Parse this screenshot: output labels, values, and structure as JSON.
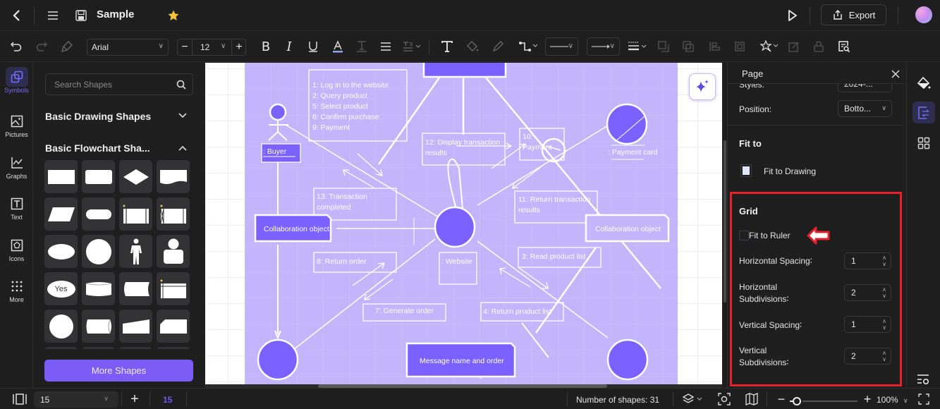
{
  "app": {
    "title": "Sample",
    "export_label": "Export"
  },
  "toolbar": {
    "font_family": "Arial",
    "font_size": "12"
  },
  "rail": {
    "items": [
      {
        "label": "Symbols",
        "icon": "symbols-icon",
        "active": true
      },
      {
        "label": "Pictures",
        "icon": "pictures-icon"
      },
      {
        "label": "Graphs",
        "icon": "graphs-icon"
      },
      {
        "label": "Text",
        "icon": "text-icon"
      },
      {
        "label": "Icons",
        "icon": "icons-icon"
      },
      {
        "label": "More",
        "icon": "more-grid-icon"
      }
    ]
  },
  "shapes_panel": {
    "search_placeholder": "Search Shapes",
    "sections": [
      {
        "title": "Basic Drawing Shapes",
        "expanded": false
      },
      {
        "title": "Basic Flowchart Sha...",
        "expanded": true
      }
    ],
    "tile_yes_label": "Yes",
    "more_shapes_label": "More Shapes"
  },
  "diagram": {
    "actor_label": ": Buyer",
    "messages_box": [
      "1: Log in to the website",
      "2: Query product",
      "5: Select product",
      "6: Confirm purchase",
      "9: Payment"
    ],
    "msg12": [
      "12: Display transaction",
      "results"
    ],
    "msg10": [
      "10:",
      "Payment"
    ],
    "payment_card": ": Payment card",
    "msg13": [
      "13: Transaction",
      "completed"
    ],
    "msg11": [
      "11: Return transaction",
      "results"
    ],
    "collab_left": "Collaboration object",
    "collab_right": "Collaboration object",
    "msg8": "8: Return order",
    "website": ": Website",
    "msg3": "3: Read product list",
    "msg7": "7: Generate order",
    "msg4": "4: Return product list",
    "message_name": "Message name and order"
  },
  "props": {
    "title": "Page",
    "styles_label": "Styles:",
    "styles_value": "2024-...",
    "position_label": "Position:",
    "position_value": "Botto...",
    "fit_to_heading": "Fit to",
    "fit_to_drawing": "Fit to Drawing",
    "grid_heading": "Grid",
    "fit_to_ruler": "Fit to Ruler",
    "fit_to_ruler_checked": false,
    "h_spacing_label": "Horizontal Spacing∶",
    "h_spacing_value": "1",
    "h_subdiv_label_1": "Horizontal",
    "h_subdiv_label_2": "Subdivisions∶",
    "h_subdiv_value": "2",
    "v_spacing_label": "Vertical Spacing∶",
    "v_spacing_value": "1",
    "v_subdiv_label_1": "Vertical",
    "v_subdiv_label_2": "Subdivisions∶",
    "v_subdiv_value": "2"
  },
  "status": {
    "page_select": "15",
    "page_tab": "15",
    "shape_count": "Number of shapes: 31",
    "zoom_level": "100%",
    "zoom_fraction": 0.1
  },
  "colors": {
    "accent": "#7b5cf6",
    "diagram_bg": "#c2b5fb",
    "node_fill": "#7b61ff",
    "highlight": "#e8202a",
    "star": "#f5c23b"
  }
}
